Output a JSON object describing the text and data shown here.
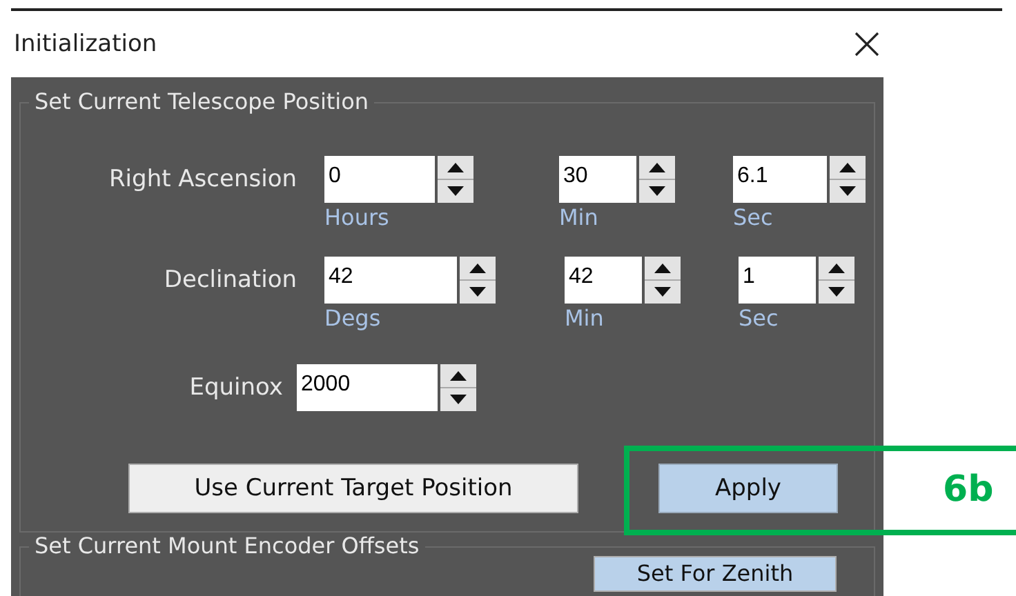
{
  "window": {
    "title": "Initialization"
  },
  "groups": [
    {
      "legend": "Set Current Telescope Position"
    },
    {
      "legend": "Set Current Mount Encoder Offsets"
    }
  ],
  "right_ascension": {
    "label": "Right Ascension",
    "fields": [
      {
        "value": "0",
        "caption": "Hours"
      },
      {
        "value": "30",
        "caption": "Min"
      },
      {
        "value": "6.1",
        "caption": "Sec"
      }
    ]
  },
  "declination": {
    "label": "Declination",
    "fields": [
      {
        "value": "42",
        "caption": "Degs"
      },
      {
        "value": "42",
        "caption": "Min"
      },
      {
        "value": "1",
        "caption": "Sec"
      }
    ]
  },
  "equinox": {
    "label": "Equinox",
    "value": "2000"
  },
  "buttons": [
    {
      "label": "Use Current Target Position",
      "kind": "plain"
    },
    {
      "label": "Apply",
      "kind": "default"
    }
  ],
  "encoder_buttons": [
    {
      "label": "Set For Zenith"
    }
  ],
  "annotation": {
    "label": "6b"
  }
}
